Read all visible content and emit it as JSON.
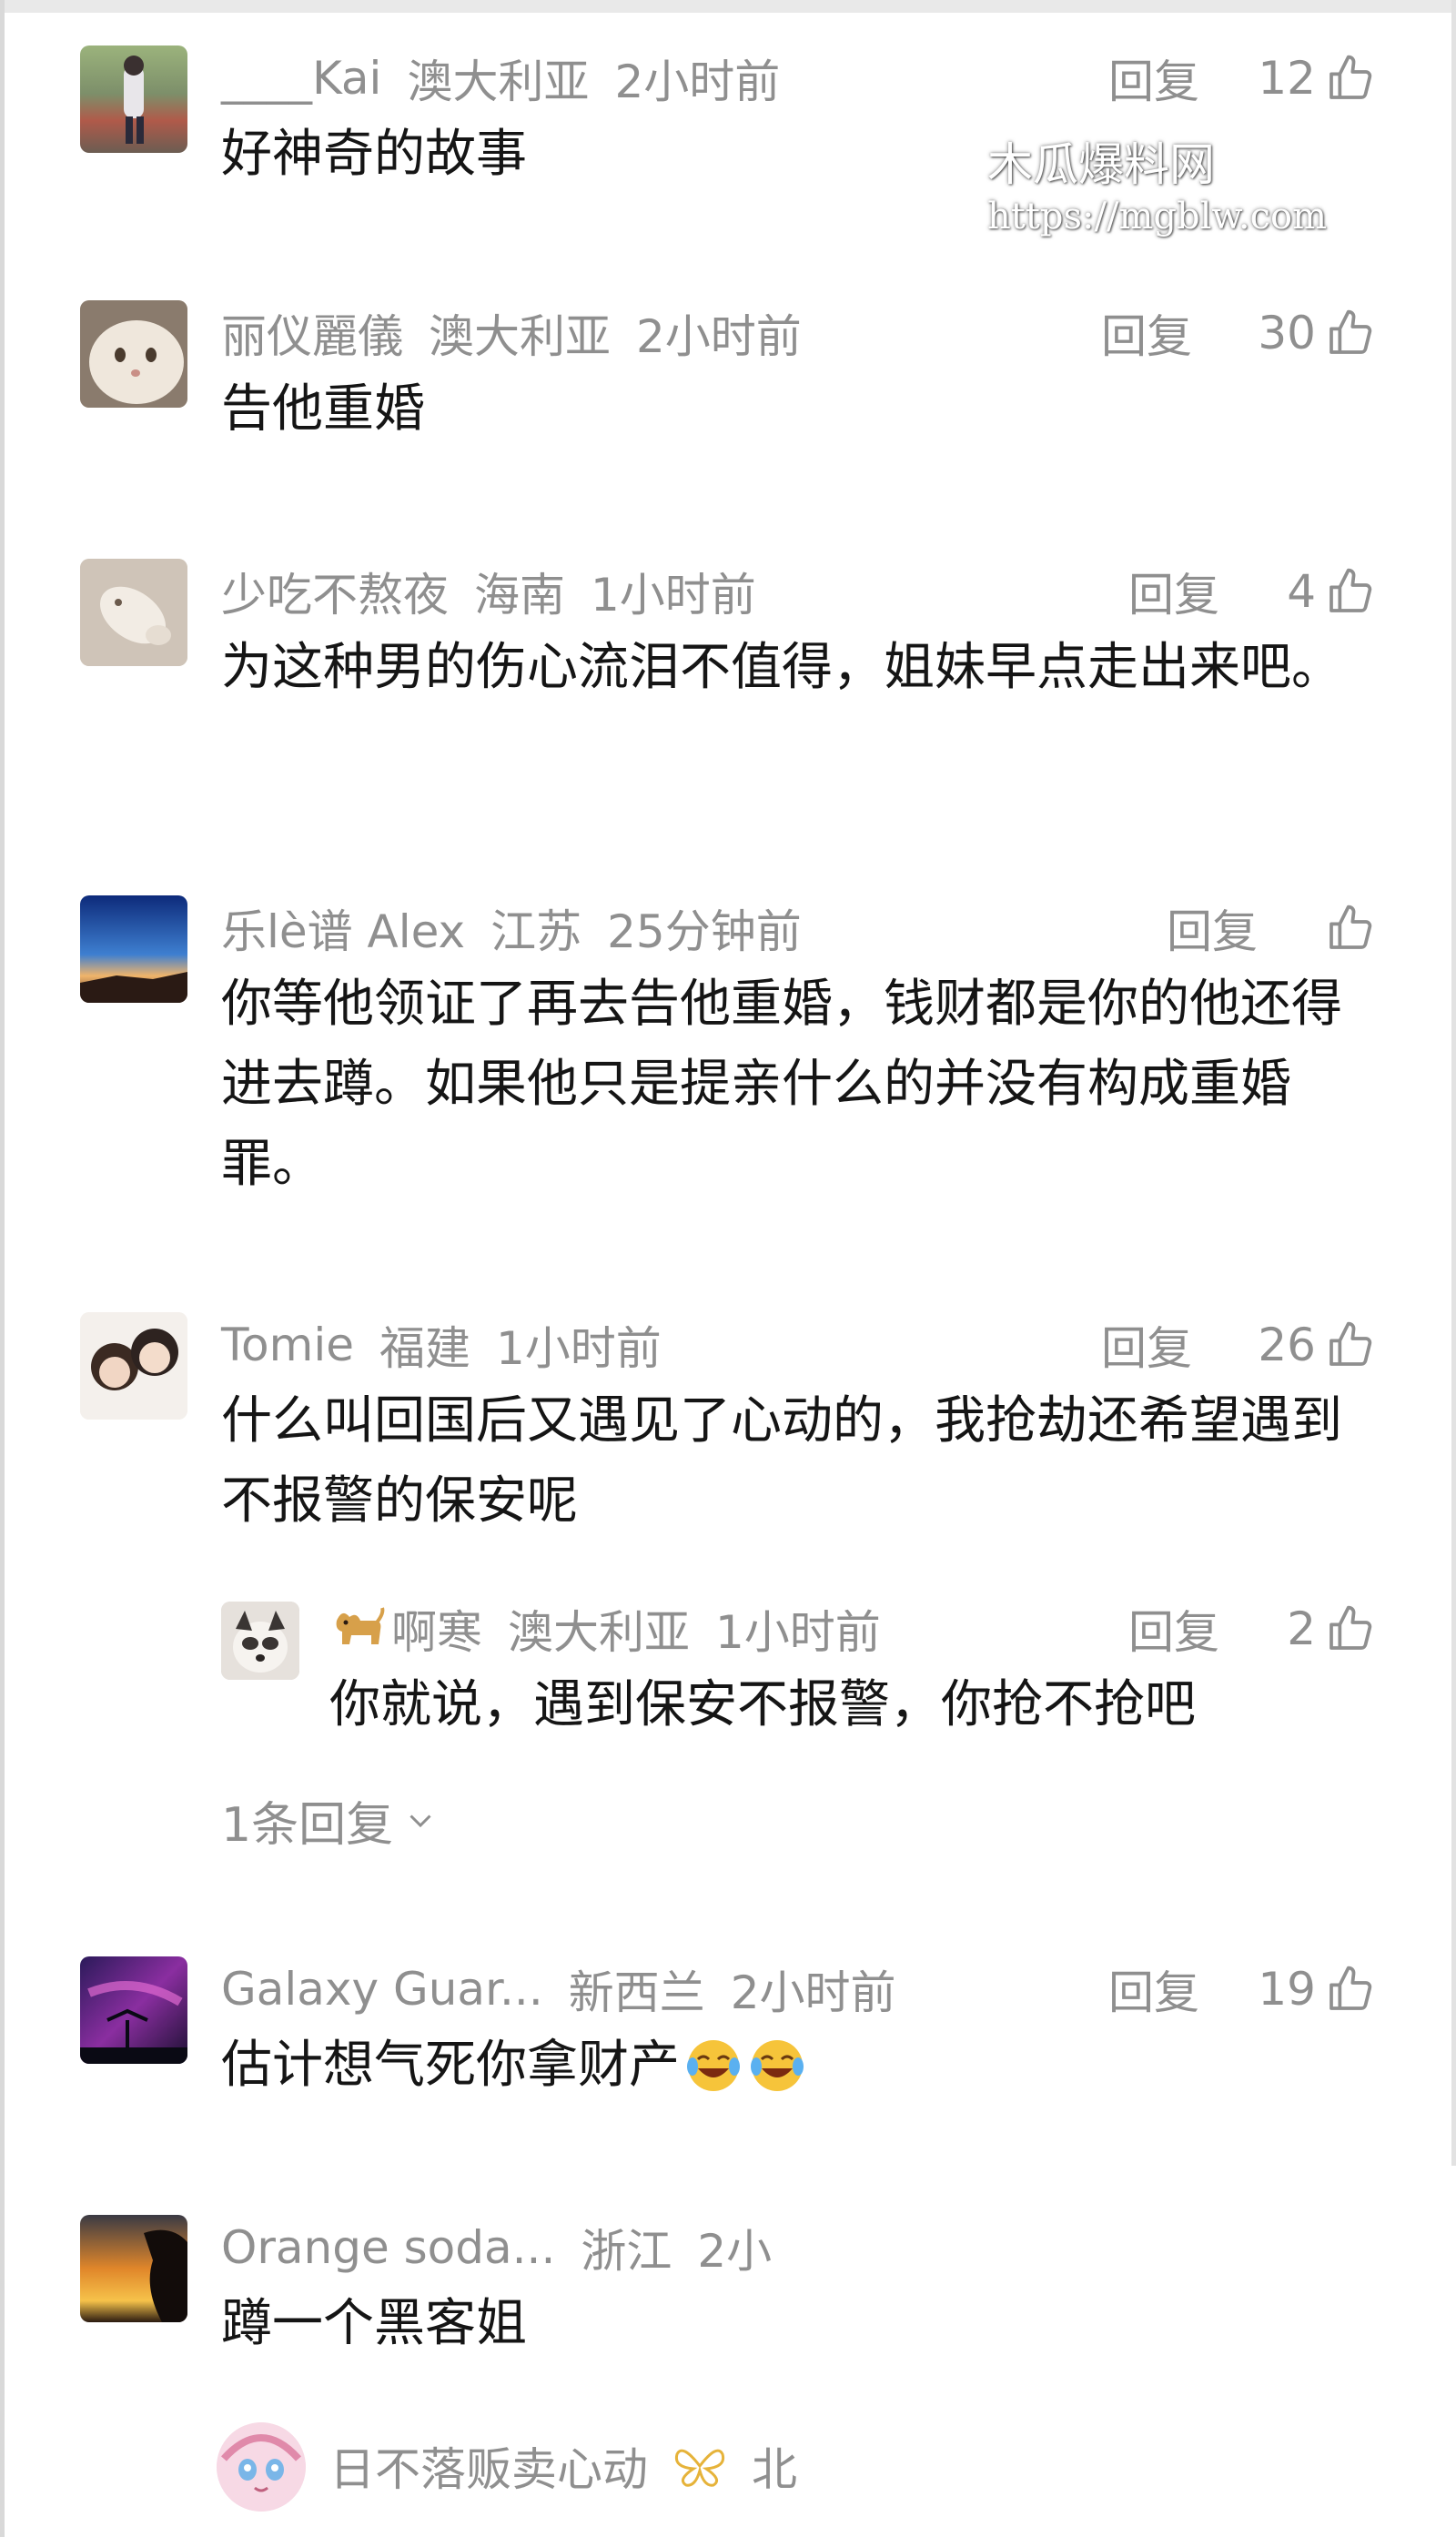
{
  "watermark": {
    "line1": "木瓜爆料网",
    "line2": "https://mgblw.com"
  },
  "reply_label": "回复",
  "comments": [
    {
      "user": "____Kai",
      "location": "澳大利亚",
      "time": "2小时前",
      "likes": "12",
      "text": "好神奇的故事"
    },
    {
      "user": "丽仪麗儀",
      "location": "澳大利亚",
      "time": "2小时前",
      "likes": "30",
      "text": "告他重婚"
    },
    {
      "user": "少吃不熬夜",
      "location": "海南",
      "time": "1小时前",
      "likes": "4",
      "text": "为这种男的伤心流泪不值得，姐妹早点走出来吧。"
    },
    {
      "user": "乐lè谱 Alex",
      "location": "江苏",
      "time": "25分钟前",
      "likes": "",
      "text": "你等他领证了再去告他重婚，钱财都是你的他还得进去蹲。如果他只是提亲什么的并没有构成重婚罪。"
    },
    {
      "user": "Tomie",
      "location": "福建",
      "time": "1小时前",
      "likes": "26",
      "text": "什么叫回国后又遇见了心动的，我抢劫还希望遇到不报警的保安呢"
    },
    {
      "user": "Galaxy Guar...",
      "location": "新西兰",
      "time": "2小时前",
      "likes": "19",
      "text": "估计想气死你拿财产"
    },
    {
      "user": "Orange soda...",
      "location": "浙江",
      "time": "2小",
      "likes": "",
      "text": "蹲一个黑客姐"
    },
    {
      "user": "日不落贩卖心动",
      "location": "北",
      "time": "",
      "likes": "",
      "text": ""
    }
  ],
  "reply": {
    "user": "啊寒",
    "location": "澳大利亚",
    "time": "1小时前",
    "likes": "2",
    "text": "你就说，遇到保安不报警，你抢不抢吧"
  },
  "expand_replies": "1条回复",
  "icons": [
    "thumbs-up-icon",
    "chevron-down-icon",
    "dog-emoji-icon",
    "laugh-cry-emoji-icon",
    "butterfly-icon"
  ],
  "colors": {
    "meta_gray": "#8f8f8f",
    "text": "#151515",
    "background": "#ffffff"
  }
}
